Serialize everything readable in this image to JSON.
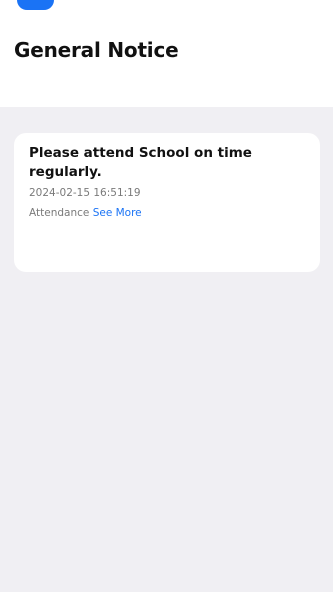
{
  "header": {
    "title": "General Notice"
  },
  "notice": {
    "title": "Please attend School on time regularly.",
    "date": "2024-02-15 16:51:19",
    "category": "Attendance",
    "see_more_label": "See More"
  },
  "colors": {
    "accent": "#1a73f5",
    "background": "#f0eff3",
    "card": "#ffffff"
  }
}
